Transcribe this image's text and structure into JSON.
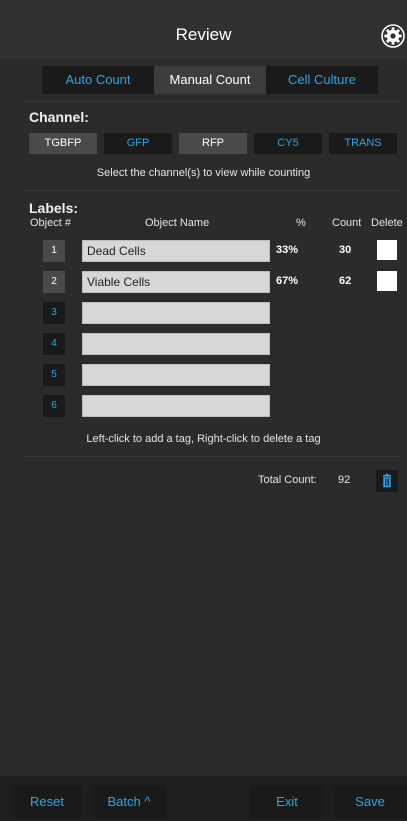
{
  "header": {
    "title": "Review",
    "settings_icon": "gear-icon"
  },
  "tabs": [
    {
      "label": "Auto Count",
      "active": false
    },
    {
      "label": "Manual Count",
      "active": true
    },
    {
      "label": "Cell Culture",
      "active": false
    }
  ],
  "channel": {
    "heading": "Channel:",
    "buttons": [
      {
        "label": "TGBFP",
        "selected": true
      },
      {
        "label": "GFP",
        "selected": false
      },
      {
        "label": "RFP",
        "selected": true
      },
      {
        "label": "CY5",
        "selected": false
      },
      {
        "label": "TRANS",
        "selected": false
      }
    ],
    "hint": "Select the channel(s) to view while counting"
  },
  "labels": {
    "heading": "Labels:",
    "columns": {
      "object_num": "Object #",
      "object_name": "Object Name",
      "percent": "%",
      "count": "Count",
      "delete": "Delete"
    },
    "rows": [
      {
        "num": "1",
        "name": "Dead Cells",
        "percent": "33%",
        "count": "30",
        "show_stats": true
      },
      {
        "num": "2",
        "name": "Viable Cells",
        "percent": "67%",
        "count": "62",
        "show_stats": true
      },
      {
        "num": "3",
        "name": "",
        "percent": "",
        "count": "",
        "show_stats": false
      },
      {
        "num": "4",
        "name": "",
        "percent": "",
        "count": "",
        "show_stats": false
      },
      {
        "num": "5",
        "name": "",
        "percent": "",
        "count": "",
        "show_stats": false
      },
      {
        "num": "6",
        "name": "",
        "percent": "",
        "count": "",
        "show_stats": false
      }
    ],
    "hint": "Left-click to add a tag, Right-click to delete a tag"
  },
  "total": {
    "label": "Total Count:",
    "value": "92",
    "trash_icon": "trash-icon"
  },
  "footer": {
    "reset": "Reset",
    "batch": "Batch ^",
    "exit": "Exit",
    "save": "Save"
  },
  "colors": {
    "accent": "#2ba6ea",
    "background": "#2b2b2b",
    "button_dark": "#1a1a1a"
  }
}
